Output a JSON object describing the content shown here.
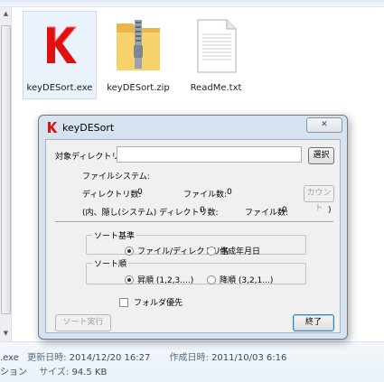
{
  "files": [
    {
      "name": "keyDESort.exe",
      "icon": "keydesort-app-icon",
      "selected": true
    },
    {
      "name": "keyDESort.zip",
      "icon": "zip-folder-icon",
      "selected": false
    },
    {
      "name": "ReadMe.txt",
      "icon": "text-file-icon",
      "selected": false
    }
  ],
  "status": {
    "line1_prefix": ".exe",
    "modified_label": "更新日時:",
    "modified_value": "2014/12/20 16:27",
    "created_label": "作成日時:",
    "created_value": "2011/10/03 6:16",
    "line2_prefix": "ション",
    "size_label": "サイズ:",
    "size_value": "94.5 KB"
  },
  "dialog": {
    "title": "keyDESort",
    "target_dir_label": "対象ディレクトリ",
    "target_dir_value": "",
    "select_button": "選択",
    "filesystem_label": "ファイルシステム:",
    "dir_count_label": "ディレクトリ数:",
    "dir_count_value": "0",
    "file_count_label": "ファイル数:",
    "file_count_value": "0",
    "count_button": "カウント",
    "hidden_dir_label": "(内、隠し(システム) ディレクトリ数:",
    "hidden_dir_value": "0",
    "hidden_file_label": "ファイル数:",
    "hidden_file_value": "0",
    "hidden_close_paren": ")",
    "sort_basis_legend": "ソート基準",
    "sort_basis_options": [
      "ファイル/ディレクトリ名",
      "作成年月日"
    ],
    "sort_order_legend": "ソート順",
    "sort_order_options": [
      "昇順 (1,2,3....)",
      "降順 (3,2,1...)"
    ],
    "folder_first_label": "フォルダ優先",
    "run_button": "ソート実行",
    "exit_button": "終了"
  },
  "colors": {
    "accent": "#cc0000",
    "dialog_frame": "#d6e2f0",
    "client_bg": "#f0f0f0"
  }
}
